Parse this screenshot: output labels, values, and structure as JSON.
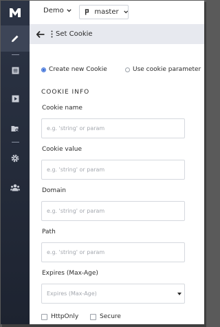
{
  "sidebar": {
    "logo": "M",
    "items": [
      {
        "icon": "pencil-icon",
        "active": true
      },
      {
        "icon": "document-icon",
        "active": false
      },
      {
        "icon": "play-icon",
        "active": false
      },
      {
        "icon": "folder-settings-icon",
        "active": false
      },
      {
        "icon": "gear-icon",
        "active": false
      },
      {
        "icon": "users-icon",
        "active": false
      }
    ]
  },
  "topbar": {
    "project": "Demo",
    "branch": "master"
  },
  "header": {
    "title": "Set Cookie"
  },
  "form": {
    "mode_options": [
      {
        "label": "Create new Cookie",
        "selected": true
      },
      {
        "label": "Use cookie parameter",
        "selected": false
      }
    ],
    "section_title": "COOKIE INFO",
    "fields": [
      {
        "label": "Cookie name",
        "placeholder": "e.g. 'string' or param",
        "value": ""
      },
      {
        "label": "Cookie value",
        "placeholder": "e.g. 'string' or param",
        "value": ""
      },
      {
        "label": "Domain",
        "placeholder": "e.g. 'string' or param",
        "value": ""
      },
      {
        "label": "Path",
        "placeholder": "e.g. 'string' or param",
        "value": ""
      }
    ],
    "expires": {
      "label": "Expires (Max-Age)",
      "selected": "Expires (Max-Age)"
    },
    "checkboxes": [
      {
        "label": "HttpOnly",
        "checked": false
      },
      {
        "label": "Secure",
        "checked": false
      }
    ]
  },
  "colors": {
    "sidebar_bg": "#262d3b",
    "sidebar_active": "#3d4557",
    "header_bg": "#e7e9ef",
    "accent": "#3b6fd8"
  }
}
